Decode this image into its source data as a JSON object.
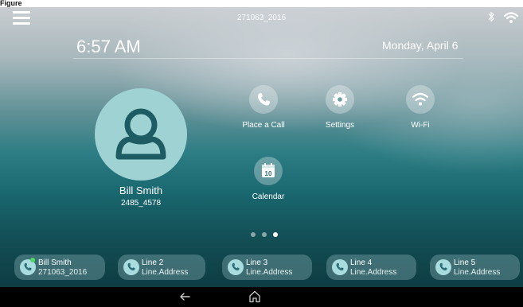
{
  "top_legend": "Figure",
  "status_bar": {
    "device_id": "271063_2016",
    "menu_icon": "hamburger-menu-icon",
    "bluetooth_icon": "bluetooth-icon",
    "wifi_icon": "wifi-icon"
  },
  "header": {
    "time": "6:57 AM",
    "date": "Monday, April 6"
  },
  "user": {
    "name": "Bill Smith",
    "number": "2485_4578",
    "avatar_icon": "person-icon"
  },
  "apps": [
    {
      "label": "Place a Call",
      "icon": "phone-icon"
    },
    {
      "label": "Settings",
      "icon": "gear-icon"
    },
    {
      "label": "Wi-Fi",
      "icon": "wifi-icon"
    },
    {
      "label": "Calendar",
      "icon": "calendar-icon",
      "icon_text": "10"
    }
  ],
  "pager": {
    "total": 3,
    "active_index": 2
  },
  "lines": [
    {
      "name": "Bill Smith",
      "address": "271063_2016",
      "status": "active"
    },
    {
      "name": "Line 2",
      "address": "Line.Address",
      "status": "idle"
    },
    {
      "name": "Line 3",
      "address": "Line.Address",
      "status": "idle"
    },
    {
      "name": "Line 4",
      "address": "Line.Address",
      "status": "idle"
    },
    {
      "name": "Line 5",
      "address": "Line.Address",
      "status": "idle"
    }
  ],
  "navigation": {
    "back_icon": "back-arrow-icon",
    "home_icon": "home-icon"
  },
  "colors": {
    "avatar_bg": "#9fd2d3",
    "line_active_dot": "#4cd964",
    "accent_teal": "#1a6870"
  }
}
